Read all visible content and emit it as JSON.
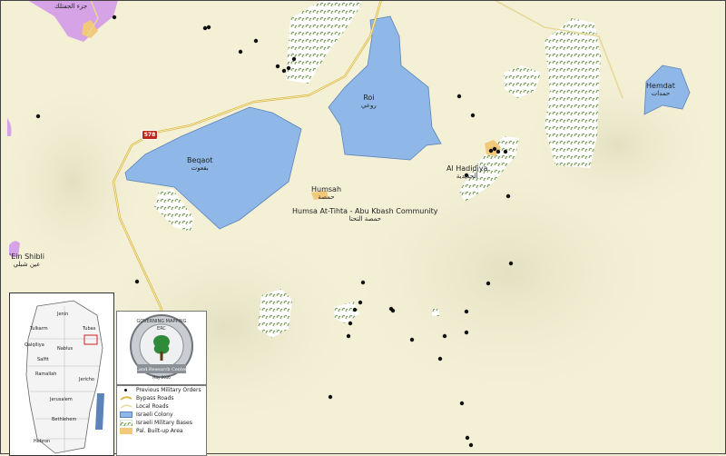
{
  "colors": {
    "background": "#f3f0d6",
    "colony": "#8fb8e8",
    "colony_border": "#5c84b8",
    "military_base": "#7ba05a",
    "built_up": "#f2c87a",
    "bypass_road": "#d9b84a",
    "local_road": "#e8d89a",
    "order_point": "#111111",
    "ein_shibli": "#d6a3e6"
  },
  "road_badge": "578",
  "places": {
    "jiftlik": {
      "ar": "جزء الجفتلك"
    },
    "roi": {
      "en": "Roi",
      "ar": "روعي"
    },
    "hemdat": {
      "en": "Hemdat",
      "ar": "حمدات"
    },
    "beqaot": {
      "en": "Beqaot",
      "ar": "بقعوت"
    },
    "al_hadidiya": {
      "en": "Al Hadidiya",
      "ar": "الحديدية"
    },
    "humsah": {
      "en": "Humsah",
      "ar": "حمصة"
    },
    "humsa_community": {
      "en": "Humsa At-Tihta - Abu Kbash Community",
      "ar": "حمصة التحتا"
    },
    "ein_shibli": {
      "en": "'Ein Shibli",
      "ar": "عين شبلي"
    }
  },
  "inset": {
    "towns": [
      "Jenin",
      "Tulkarm",
      "Tubas",
      "Qalqiliya",
      "Nablus",
      "Salfit",
      "Ramallah",
      "Jericho",
      "Jerusalem",
      "Bethlehem",
      "Hebron"
    ]
  },
  "logo": {
    "top_text": "GOVERNING MAPPING",
    "code": "ERC",
    "name": "Land Research Center",
    "date": "May 2016"
  },
  "legend": {
    "items": [
      {
        "label": "Previous Military Orders",
        "symbol": "dot"
      },
      {
        "label": "Bypass Roads",
        "symbol": "bypass"
      },
      {
        "label": "Local Roads",
        "symbol": "local"
      },
      {
        "label": "Israeli Colony",
        "symbol": "colony"
      },
      {
        "label": "Israeli Military Bases",
        "symbol": "base"
      },
      {
        "label": "Pal. Built-up Area",
        "symbol": "builtup"
      }
    ]
  },
  "points_note": "military order locations",
  "order_points": [
    [
      126,
      19
    ],
    [
      226,
      31
    ],
    [
      230,
      30
    ],
    [
      282,
      45
    ],
    [
      265,
      57
    ],
    [
      306,
      73
    ],
    [
      313,
      78
    ],
    [
      318,
      75
    ],
    [
      324,
      65
    ],
    [
      42,
      128
    ],
    [
      506,
      106
    ],
    [
      521,
      127
    ],
    [
      541,
      166
    ],
    [
      545,
      164
    ],
    [
      549,
      167
    ],
    [
      557,
      167
    ],
    [
      514,
      193
    ],
    [
      560,
      216
    ],
    [
      538,
      312
    ],
    [
      563,
      290
    ],
    [
      400,
      311
    ],
    [
      397,
      333
    ],
    [
      391,
      341
    ],
    [
      431,
      340
    ],
    [
      433,
      342
    ],
    [
      386,
      356
    ],
    [
      384,
      370
    ],
    [
      514,
      343
    ],
    [
      490,
      370
    ],
    [
      454,
      374
    ],
    [
      514,
      366
    ],
    [
      485,
      395
    ],
    [
      509,
      444
    ],
    [
      364,
      437
    ],
    [
      515,
      482
    ],
    [
      151,
      310
    ],
    [
      519,
      490
    ]
  ]
}
